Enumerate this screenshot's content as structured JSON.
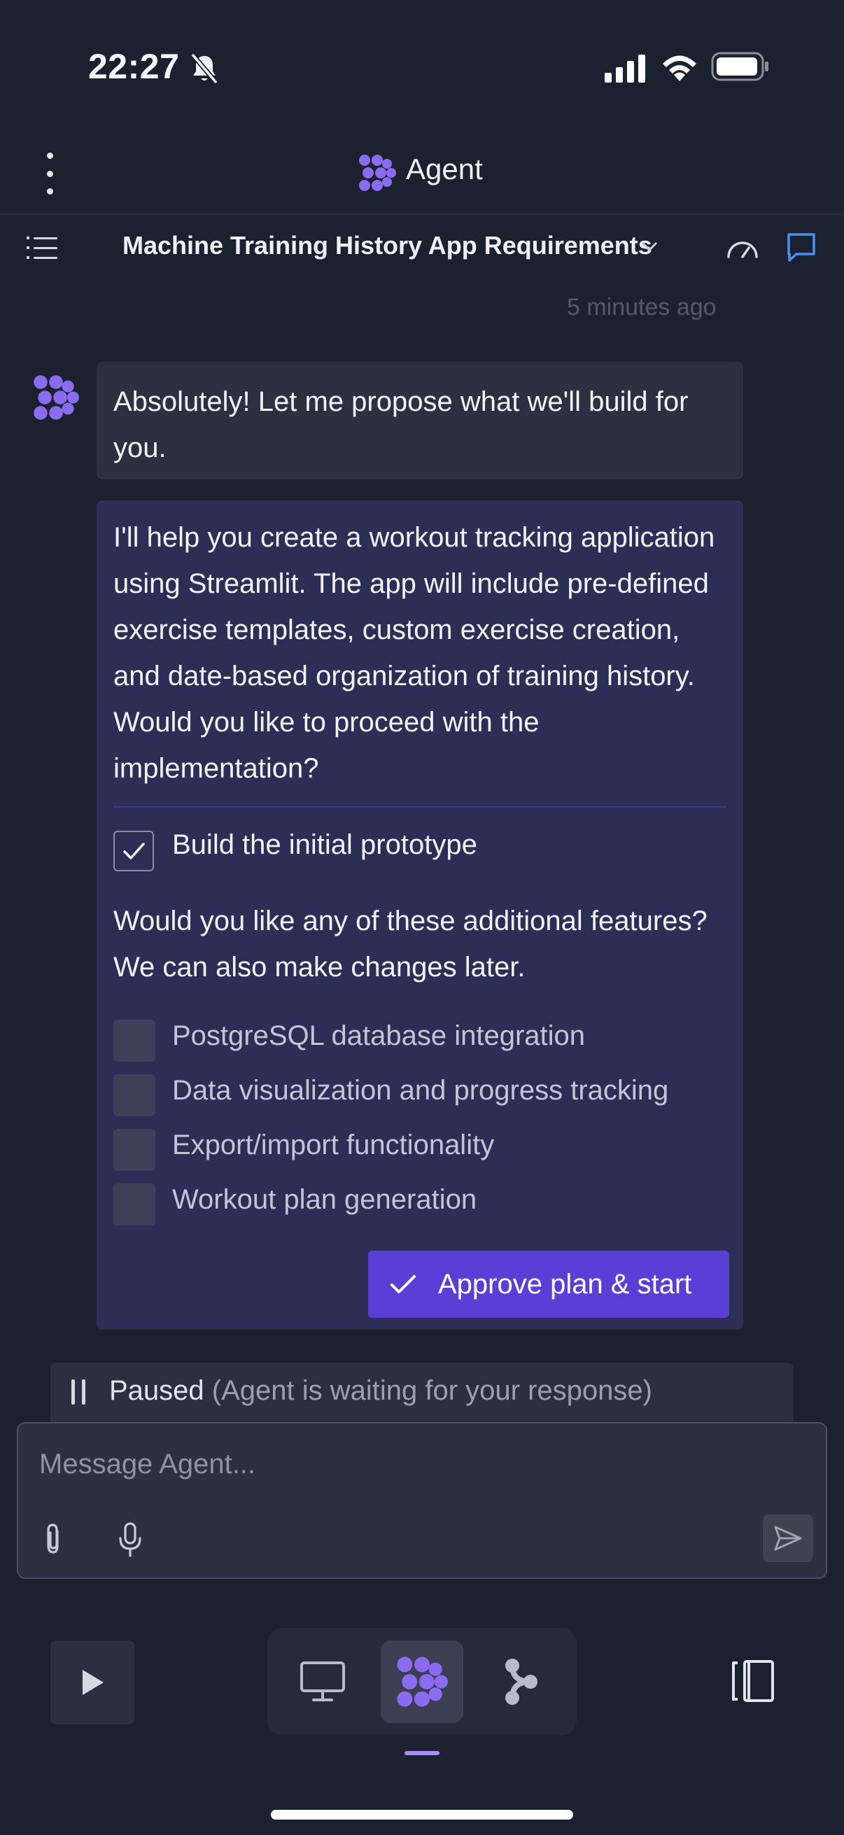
{
  "status_bar": {
    "time": "22:27"
  },
  "header": {
    "title": "Agent"
  },
  "thread": {
    "title": "Machine Training History App Requirements"
  },
  "timestamp": "5 minutes ago",
  "messages": {
    "intro": "Absolutely! Let me propose what we'll build for you.",
    "plan": "I'll help you create a workout tracking application using Streamlit. The app will include pre-defined exercise templates, custom exercise creation, and date-based organization of training history. Would you like to proceed with the implementation?",
    "prototype_label": "Build the initial prototype",
    "prototype_checked": true,
    "additional_prompt": "Would you like any of these additional features? We can also make changes later.",
    "options": [
      {
        "label": "PostgreSQL database integration",
        "checked": false
      },
      {
        "label": "Data visualization and progress tracking",
        "checked": false
      },
      {
        "label": "Export/import functionality",
        "checked": false
      },
      {
        "label": "Workout plan generation",
        "checked": false
      }
    ],
    "approve_label": "Approve plan & start"
  },
  "paused": {
    "label": "Paused",
    "detail": "(Agent is waiting for your response)"
  },
  "composer": {
    "placeholder": "Message Agent..."
  },
  "bottom_bar": {
    "active_tab": "agent"
  },
  "colors": {
    "accent": "#5a3fd6",
    "logo": "#8b6cf0",
    "link": "#4c8ff5",
    "background": "#1c2130"
  }
}
